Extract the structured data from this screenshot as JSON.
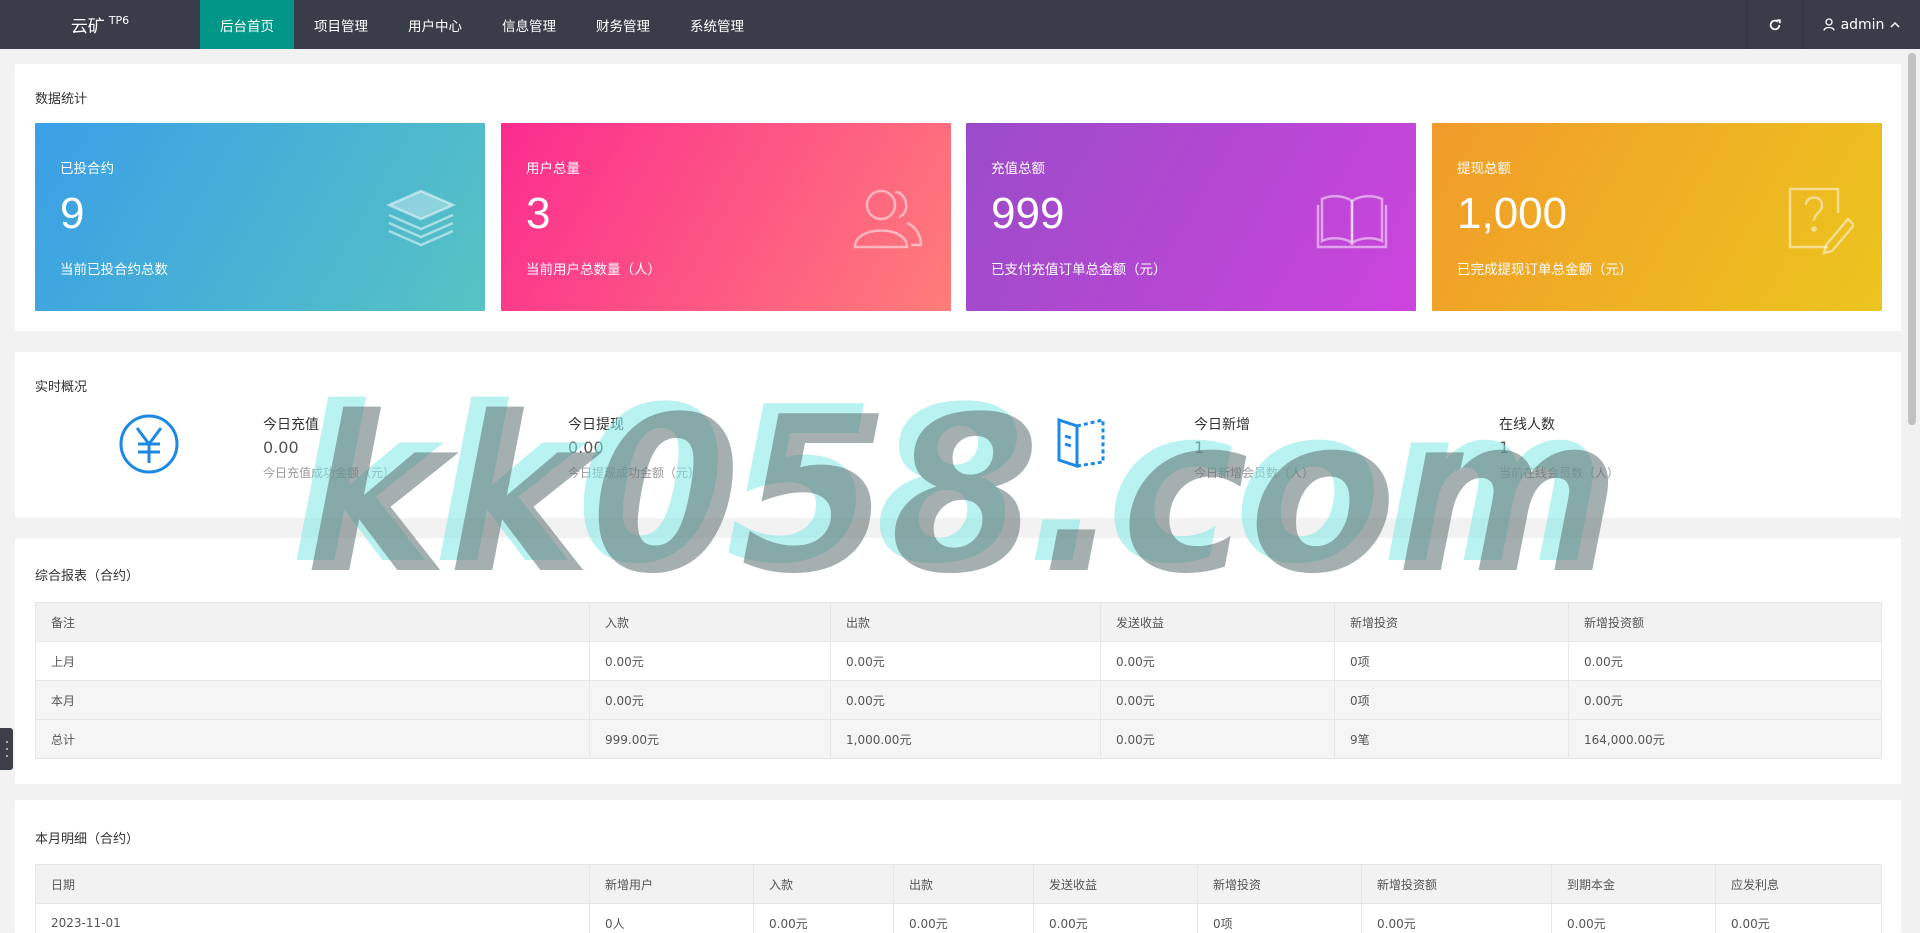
{
  "header": {
    "logo": "云矿",
    "logo_sup": "TP6",
    "nav": [
      "后台首页",
      "项目管理",
      "用户中心",
      "信息管理",
      "财务管理",
      "系统管理"
    ],
    "user": "admin"
  },
  "stats": {
    "title": "数据统计",
    "cards": [
      {
        "label": "已投合约",
        "value": "9",
        "desc": "当前已投合约总数",
        "icon": "layers-icon",
        "gradient": [
          "#3a9fe6",
          "#57c3c3"
        ]
      },
      {
        "label": "用户总量",
        "value": "3",
        "desc": "当前用户总数量（人）",
        "icon": "users-icon",
        "gradient": [
          "#fb2c8f",
          "#fe7d79"
        ]
      },
      {
        "label": "充值总额",
        "value": "999",
        "desc": "已支付充值订单总金额（元）",
        "icon": "book-icon",
        "gradient": [
          "#9a4cc8",
          "#cc44dd"
        ]
      },
      {
        "label": "提现总额",
        "value": "1,000",
        "desc": "已完成提现订单总金额（元）",
        "icon": "edit-note-icon",
        "gradient": [
          "#f19b2a",
          "#ecc51e"
        ]
      }
    ]
  },
  "realtime": {
    "title": "实时概况",
    "items": [
      {
        "label": "今日充值",
        "value": "0.00",
        "desc": "今日充值成功金额（元）"
      },
      {
        "label": "今日提现",
        "value": "0.00",
        "desc": "今日提现成功金额（元）"
      },
      {
        "label": "今日新增",
        "value": "1",
        "desc": "今日新增会员数（人）"
      },
      {
        "label": "在线人数",
        "value": "1",
        "desc": "当前在线会员数（人）"
      }
    ]
  },
  "report": {
    "title": "综合报表（合约）",
    "columns": [
      "备注",
      "入款",
      "出款",
      "发送收益",
      "新增投资",
      "新增投资额"
    ],
    "rows": [
      [
        "上月",
        "0.00元",
        "0.00元",
        "0.00元",
        "0项",
        "0.00元"
      ],
      [
        "本月",
        "0.00元",
        "0.00元",
        "0.00元",
        "0项",
        "0.00元"
      ],
      [
        "总计",
        "999.00元",
        "1,000.00元",
        "0.00元",
        "9笔",
        "164,000.00元"
      ]
    ]
  },
  "monthly": {
    "title": "本月明细（合约）",
    "columns": [
      "日期",
      "新增用户",
      "入款",
      "出款",
      "发送收益",
      "新增投资",
      "新增投资额",
      "到期本金",
      "应发利息"
    ],
    "rows": [
      [
        "2023-11-01",
        "0人",
        "0.00元",
        "0.00元",
        "0.00元",
        "0项",
        "0.00元",
        "0.00元",
        "0.00元"
      ]
    ]
  },
  "watermark": "kk058.com",
  "colors": {
    "topbar": "#393d49",
    "active_nav": "#009688",
    "icon_blue": "#1e88e5"
  }
}
